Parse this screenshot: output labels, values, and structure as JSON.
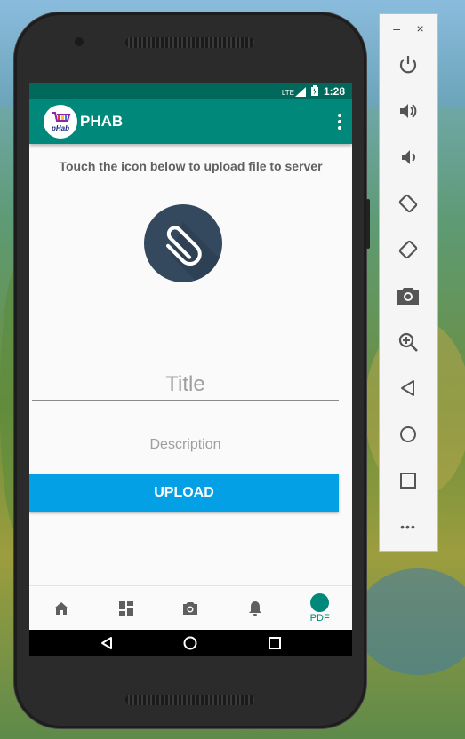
{
  "app": {
    "title": "PHAB",
    "logo_text": "pHab"
  },
  "status_bar": {
    "network": "LTE",
    "time": "1:28"
  },
  "main": {
    "instruction": "Touch the icon below to upload file to server",
    "title_placeholder": "Title",
    "description_placeholder": "Description",
    "upload_label": "UPLOAD"
  },
  "bottom_nav": {
    "items": [
      {
        "icon": "home-icon",
        "label": ""
      },
      {
        "icon": "dashboard-icon",
        "label": ""
      },
      {
        "icon": "camera-icon",
        "label": ""
      },
      {
        "icon": "bell-icon",
        "label": ""
      },
      {
        "icon": "pdf-icon",
        "label": "PDF"
      }
    ]
  },
  "emulator_panel": {
    "minimize_label": "–",
    "close_label": "×",
    "more_label": "•••",
    "tools": [
      "power-icon",
      "volume-up-icon",
      "volume-down-icon",
      "rotate-left-icon",
      "rotate-right-icon",
      "screenshot-icon",
      "zoom-icon",
      "back-icon",
      "home-icon",
      "overview-icon",
      "more-icon"
    ]
  },
  "colors": {
    "primary": "#00897b",
    "primary_dark": "#00695c",
    "accent": "#03a0e6",
    "attach_bg": "#34495e"
  }
}
